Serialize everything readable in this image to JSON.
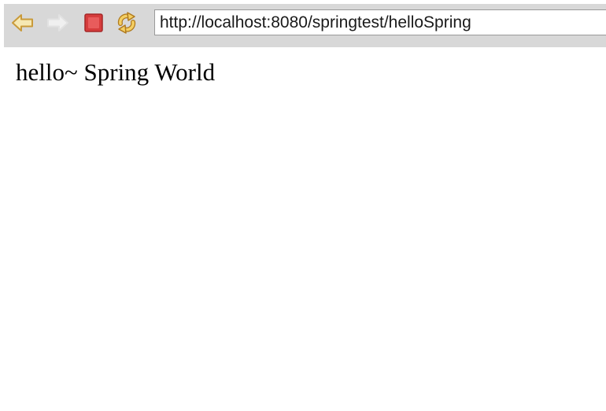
{
  "toolbar": {
    "buttons": {
      "back": {
        "icon": "back-arrow-icon"
      },
      "forward": {
        "icon": "forward-arrow-icon"
      },
      "stop": {
        "icon": "stop-icon"
      },
      "refresh": {
        "icon": "refresh-icon"
      }
    },
    "address_bar": {
      "value": "http://localhost:8080/springtest/helloSpring"
    }
  },
  "page": {
    "body_text": "hello~ Spring World"
  },
  "colors": {
    "toolbar_bg": "#d8d8d8",
    "back_arrow_fill": "#f6e8b3",
    "back_arrow_stroke": "#c99a3a",
    "forward_arrow_fill": "#f0f0f0",
    "stop_fill": "#d63c3c",
    "refresh_fill": "#e9b54a"
  }
}
